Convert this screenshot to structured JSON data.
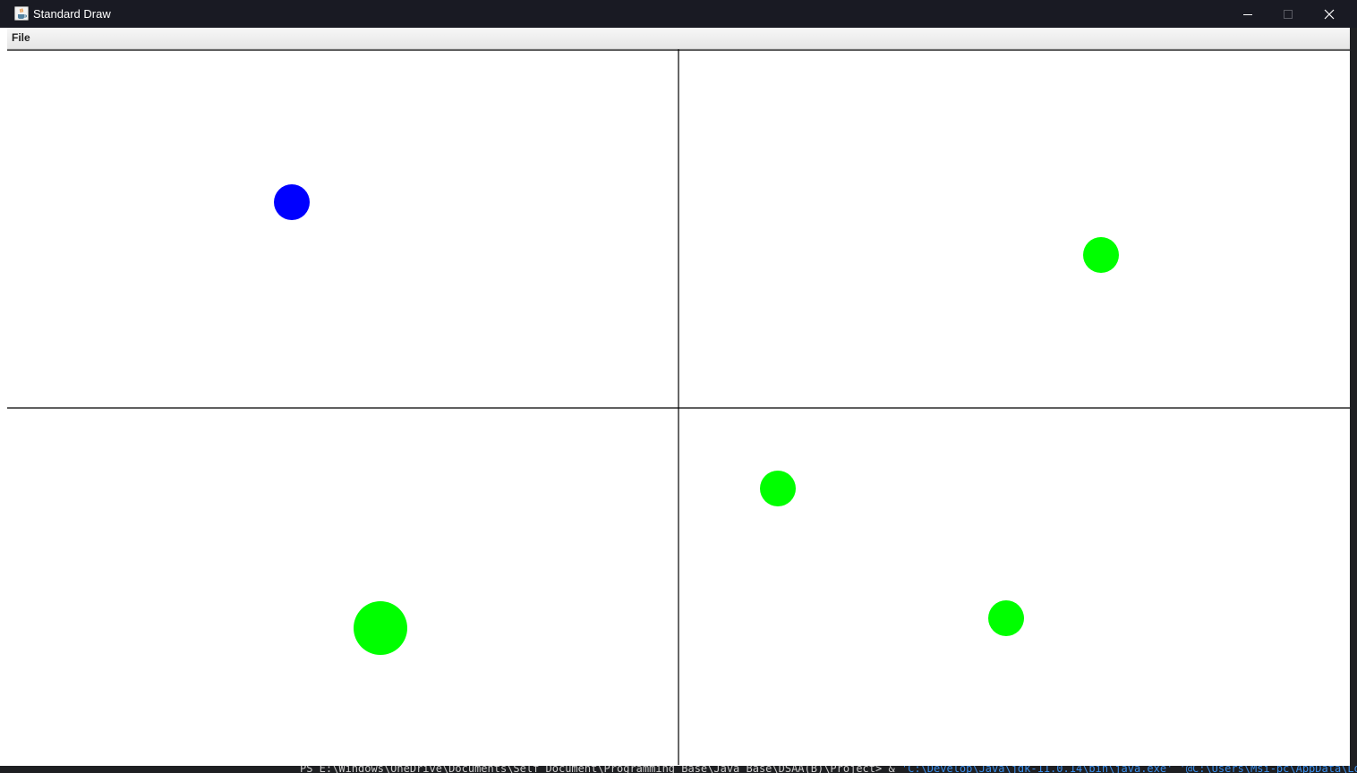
{
  "window": {
    "title": "Standard Draw"
  },
  "menubar": {
    "items": [
      {
        "label": "File"
      }
    ]
  },
  "canvas": {
    "grid": {
      "rows": 2,
      "cols": 2
    },
    "panels": [
      {
        "name": "top-left",
        "circles": [
          {
            "color": "#0000ff",
            "size": "small"
          }
        ]
      },
      {
        "name": "top-right",
        "circles": [
          {
            "color": "#00ff00",
            "size": "small"
          }
        ]
      },
      {
        "name": "bottom-left",
        "circles": [
          {
            "color": "#00ff00",
            "size": "large"
          }
        ]
      },
      {
        "name": "bottom-right",
        "circles": [
          {
            "color": "#00ff00",
            "size": "small"
          },
          {
            "color": "#00ff00",
            "size": "small"
          }
        ]
      }
    ]
  },
  "terminal": {
    "prompt": "PS E:\\Windows\\OneDrive\\Documents\\Self Document\\Programming Base\\Java Base\\DSAA(B)\\Project>  & ",
    "java_path": "'C:\\Develop\\Java\\jdk-11.0.14\\bin\\java.exe'",
    "args_path": " '@C:\\Users\\Msi-pc\\AppData\\Local\\"
  },
  "colors": {
    "titlebar": "#191a23",
    "canvas_bg": "#ffffff",
    "grid_line": "#000000",
    "blue_ball": "#0000ff",
    "green_ball": "#00ff00"
  },
  "icons": {
    "app": "java-cup-icon",
    "minimize": "minimize-icon",
    "maximize": "maximize-icon",
    "close": "close-icon"
  }
}
